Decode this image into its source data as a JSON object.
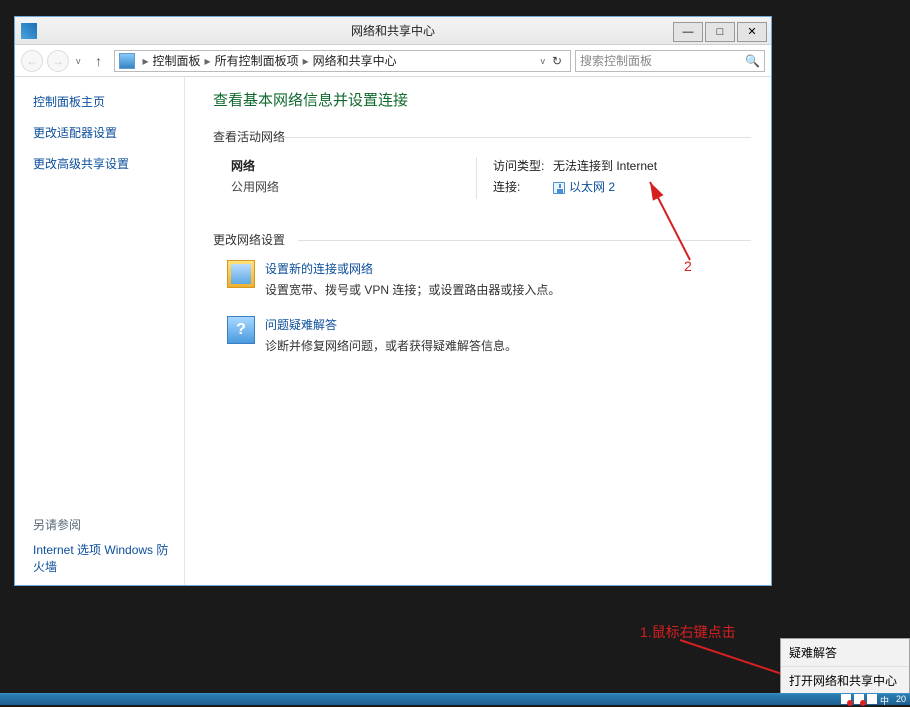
{
  "window": {
    "title": "网络和共享中心",
    "minimize": "—",
    "maximize": "□",
    "close": "✕"
  },
  "nav": {
    "back": "←",
    "forward": "→",
    "up": "↑",
    "refresh": "↻",
    "dropdown": "v"
  },
  "breadcrumb": {
    "root_icon": "computer",
    "sep": "▸",
    "items": [
      "控制面板",
      "所有控制面板项",
      "网络和共享中心"
    ]
  },
  "search": {
    "placeholder": "搜索控制面板"
  },
  "sidebar": {
    "home": "控制面板主页",
    "adapter": "更改适配器设置",
    "sharing": "更改高级共享设置",
    "seealso_label": "另请参阅",
    "internet_options": "Internet 选项",
    "firewall": "Windows 防火墙"
  },
  "main": {
    "title": "查看基本网络信息并设置连接",
    "active_networks_header": "查看活动网络",
    "network": {
      "name": "网络",
      "type": "公用网络"
    },
    "access": {
      "label": "访问类型:",
      "value": "无法连接到 Internet"
    },
    "connections": {
      "label": "连接:",
      "link": "以太网 2"
    },
    "change_settings_header": "更改网络设置",
    "opt_newconn": {
      "link": "设置新的连接或网络",
      "desc": "设置宽带、拨号或 VPN 连接；或设置路由器或接入点。"
    },
    "opt_trouble": {
      "link": "问题疑难解答",
      "desc": "诊断并修复网络问题，或者获得疑难解答信息。"
    }
  },
  "annotations": {
    "label1": "1.鼠标右键点击",
    "label2": "2"
  },
  "context_menu": {
    "troubleshoot": "疑难解答",
    "open_center": "打开网络和共享中心"
  },
  "systray": {
    "ime": "中",
    "time": "20"
  }
}
